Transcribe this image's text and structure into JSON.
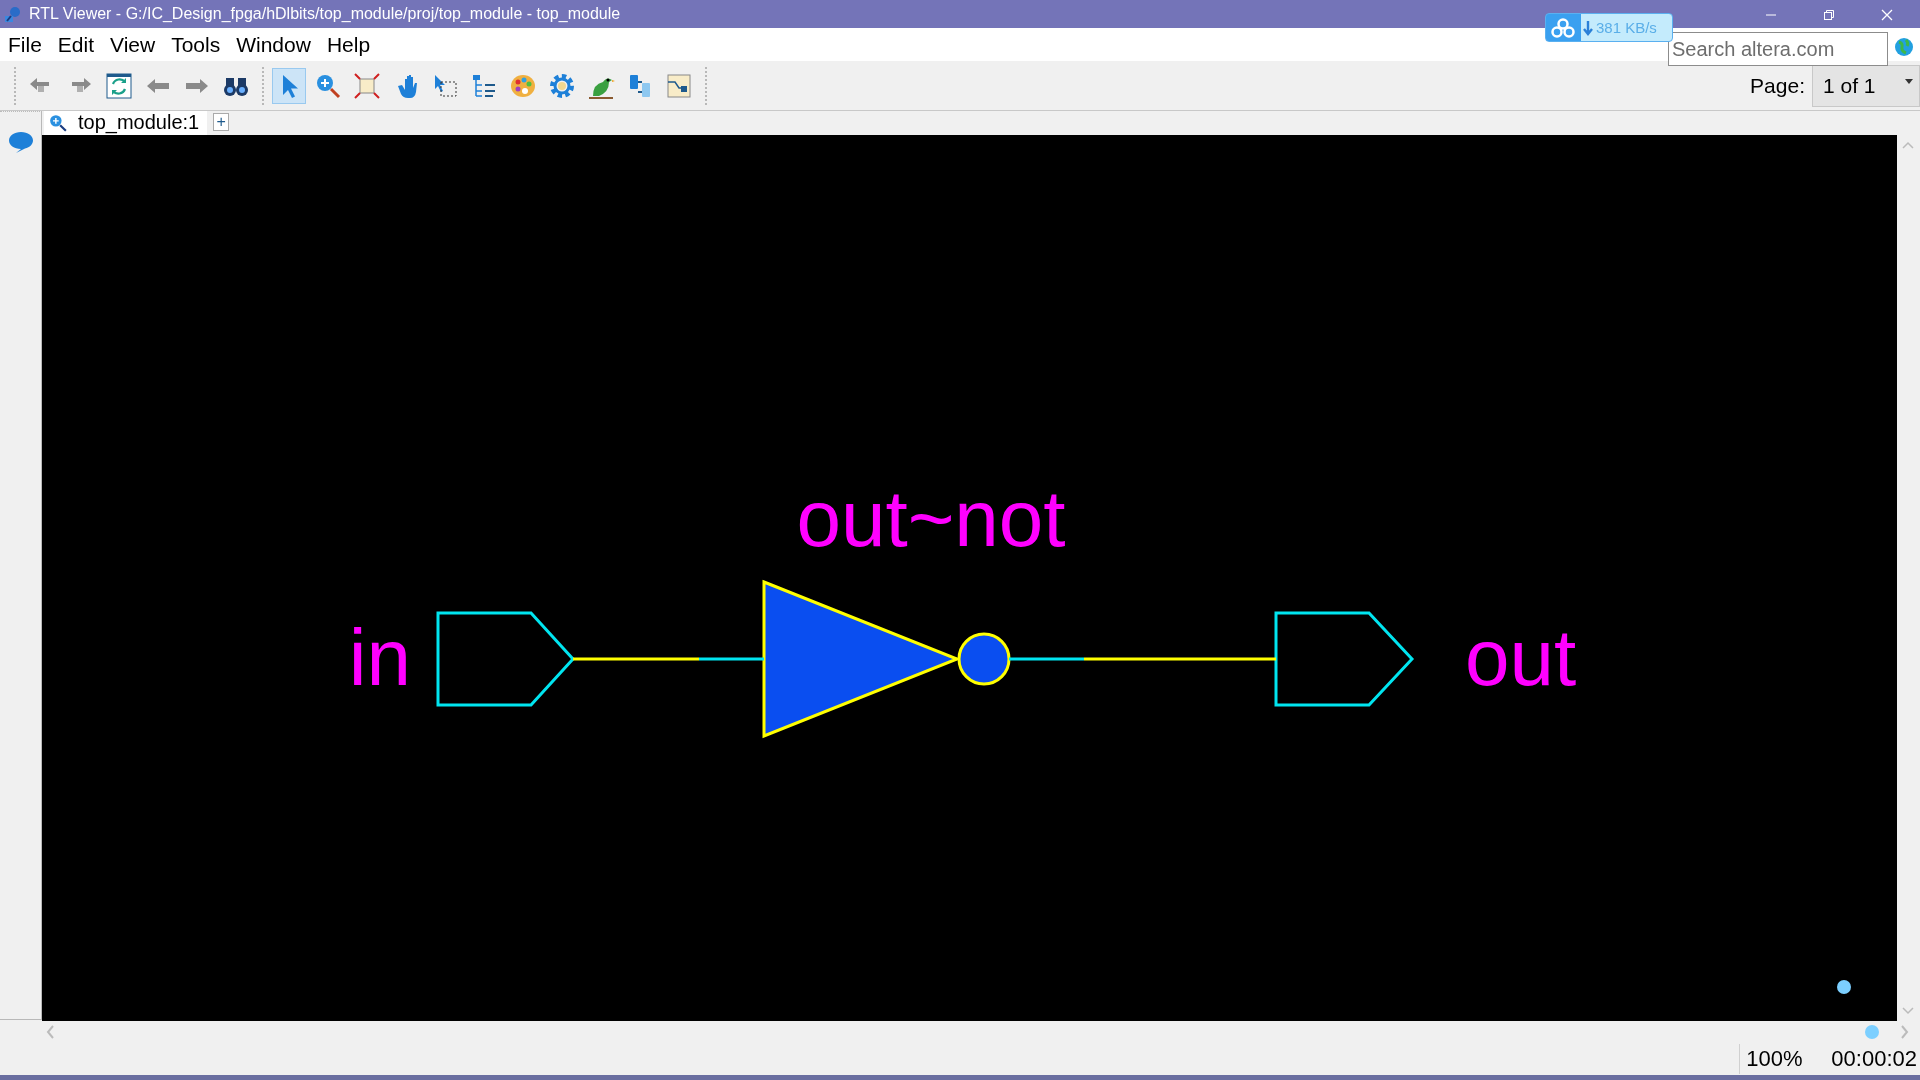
{
  "window": {
    "title": "RTL Viewer - G:/IC_Design_fpga/hDlbits/top_module/proj/top_module - top_module"
  },
  "network_badge": {
    "speed": "381 KB/s"
  },
  "menu": [
    "File",
    "Edit",
    "View",
    "Tools",
    "Window",
    "Help"
  ],
  "search": {
    "placeholder": "Search altera.com"
  },
  "toolbar": {
    "tools": [
      {
        "kind": "back",
        "selected": false
      },
      {
        "kind": "forward",
        "selected": false
      },
      {
        "kind": "refresh",
        "selected": false
      },
      {
        "kind": "prev",
        "selected": false
      },
      {
        "kind": "next",
        "selected": false
      },
      {
        "kind": "find",
        "selected": false
      },
      {
        "kind": "select",
        "selected": true
      },
      {
        "kind": "zoom",
        "selected": false
      },
      {
        "kind": "fit",
        "selected": false
      },
      {
        "kind": "hand",
        "selected": false
      },
      {
        "kind": "region",
        "selected": false
      },
      {
        "kind": "hierarchy",
        "selected": false
      },
      {
        "kind": "palette",
        "selected": false
      },
      {
        "kind": "gear",
        "selected": false
      },
      {
        "kind": "bird",
        "selected": false
      },
      {
        "kind": "split",
        "selected": false
      },
      {
        "kind": "schematic",
        "selected": false
      }
    ],
    "page_label": "Page:",
    "page_value": "1 of 1"
  },
  "tabs": [
    {
      "label": "top_module:1",
      "selected": true
    }
  ],
  "add_tab": "+",
  "schematic": {
    "nodes": [
      {
        "kind": "input_port",
        "label": "in"
      },
      {
        "kind": "not_gate",
        "label": "out~not"
      },
      {
        "kind": "output_port",
        "label": "out"
      }
    ]
  },
  "status_bar": {
    "zoom": "100%",
    "time": "00:00:02"
  }
}
